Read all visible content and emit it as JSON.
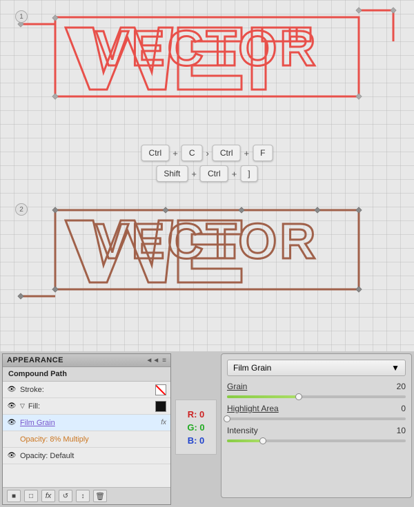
{
  "canvas": {
    "circle1_label": "1",
    "circle2_label": "2",
    "vector_text": "VECTOR",
    "shortcuts": [
      {
        "keys": [
          "Ctrl",
          "+",
          "C",
          ">",
          "Ctrl",
          "+",
          "F"
        ]
      },
      {
        "keys": [
          "Shift",
          "+",
          "Ctrl",
          "+",
          "]"
        ]
      }
    ]
  },
  "appearance_panel": {
    "title": "APPEARANCE",
    "double_arrow": "◄◄",
    "menu_icon": "≡",
    "compound_path_label": "Compound Path",
    "stroke_label": "Stroke:",
    "fill_label": "Fill:",
    "film_grain_label": "Film Grain",
    "fx_label": "fx",
    "opacity_label": "Opacity: 8% Multiply",
    "opacity_default_label": "Opacity: Default",
    "toolbar_buttons": [
      "■",
      "□",
      "fx",
      "↺",
      "↕",
      "🗑"
    ]
  },
  "rgb_display": {
    "r_label": "R: 0",
    "g_label": "G: 0",
    "b_label": "B: 0"
  },
  "film_grain_panel": {
    "dropdown_label": "Film Grain",
    "dropdown_arrow": "▼",
    "grain_label": "Grain",
    "grain_value": "20",
    "highlight_area_label": "Highlight Area",
    "highlight_area_value": "0",
    "intensity_label": "Intensity",
    "intensity_value": "10"
  }
}
